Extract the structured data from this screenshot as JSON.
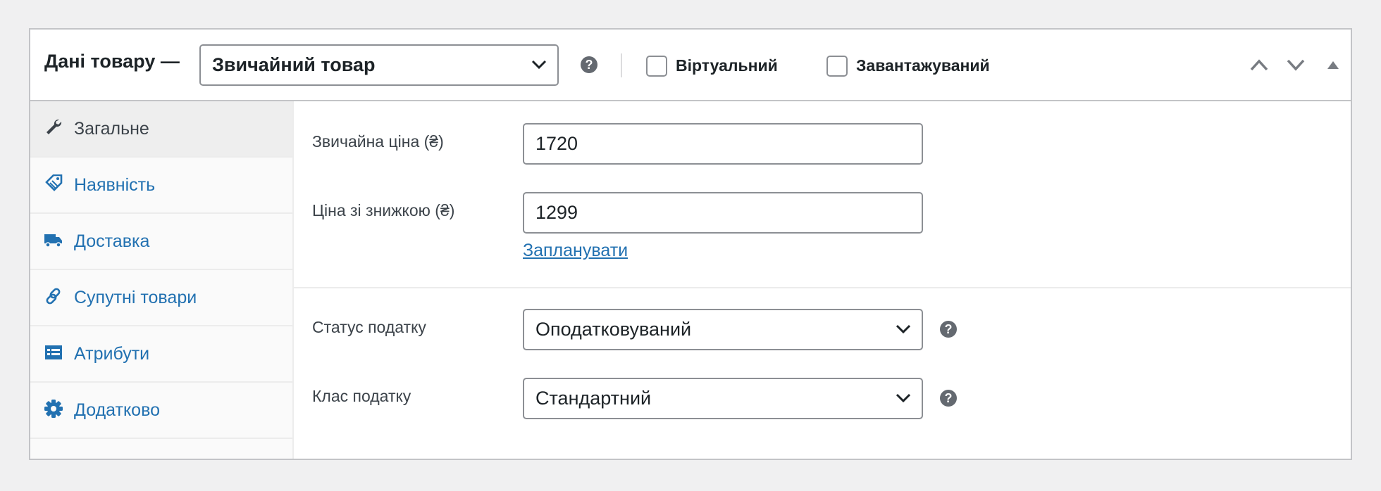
{
  "header": {
    "title": "Дані товару —",
    "product_type": "Звичайний товар",
    "virtual_label": "Віртуальний",
    "downloadable_label": "Завантажуваний"
  },
  "tabs": [
    {
      "label": "Загальне",
      "icon": "wrench-icon",
      "active": true
    },
    {
      "label": "Наявність",
      "icon": "tag-icon"
    },
    {
      "label": "Доставка",
      "icon": "truck-icon"
    },
    {
      "label": "Супутні товари",
      "icon": "link-icon"
    },
    {
      "label": "Атрибути",
      "icon": "list-table-icon"
    },
    {
      "label": "Додатково",
      "icon": "gear-icon"
    }
  ],
  "general": {
    "regular_price_label": "Звичайна ціна (₴)",
    "regular_price_value": "1720",
    "sale_price_label": "Ціна зі знижкою (₴)",
    "sale_price_value": "1299",
    "schedule_link": "Запланувати",
    "tax_status_label": "Статус податку",
    "tax_status_value": "Оподатковуваний",
    "tax_class_label": "Клас податку",
    "tax_class_value": "Стандартний"
  },
  "colors": {
    "link": "#2271b1",
    "text": "#1d2327",
    "border": "#8c8f94",
    "background": "#f0f0f1"
  }
}
